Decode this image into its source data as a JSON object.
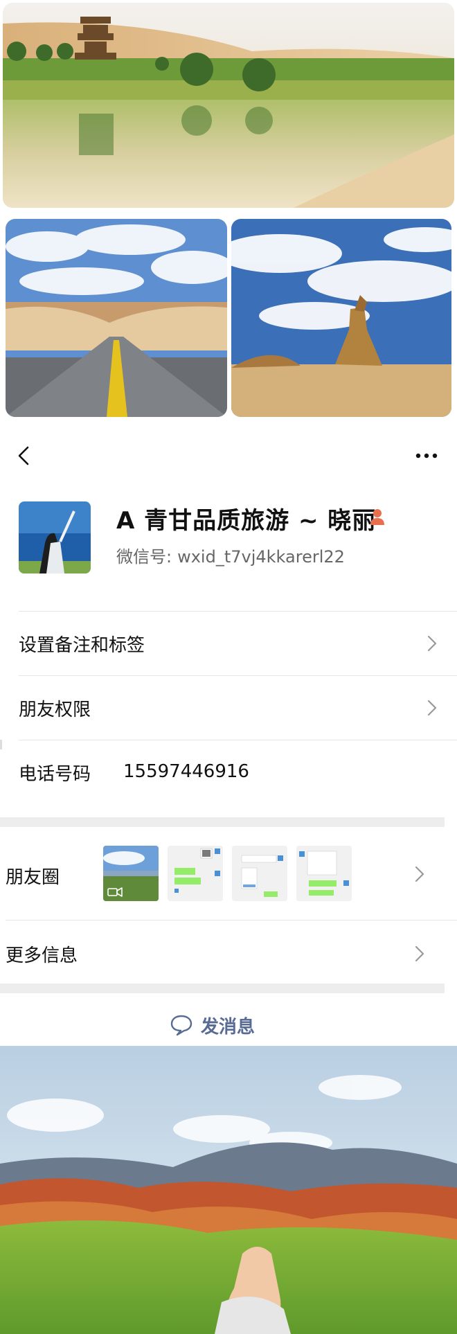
{
  "contact": {
    "name": "A 青甘品质旅游 ~ 晓丽",
    "wechat_id_label": "微信号:",
    "wechat_id": "wxid_t7vj4kkarerl22"
  },
  "rows": {
    "remarks_label": "设置备注和标签",
    "permissions_label": "朋友权限",
    "phone_label": "电话号码",
    "phone_value": "15597446916",
    "moments_label": "朋友圈",
    "more_info_label": "更多信息"
  },
  "actions": {
    "send_message_label": "发消息"
  },
  "icons": {
    "back": "chevron-left-icon",
    "more": "more-dots-icon",
    "gender": "female-icon",
    "chevron": "chevron-right-icon",
    "message": "chat-bubble-icon",
    "video": "video-icon"
  },
  "colors": {
    "link_blue": "#576b95",
    "gender_female": "#e8704f"
  }
}
